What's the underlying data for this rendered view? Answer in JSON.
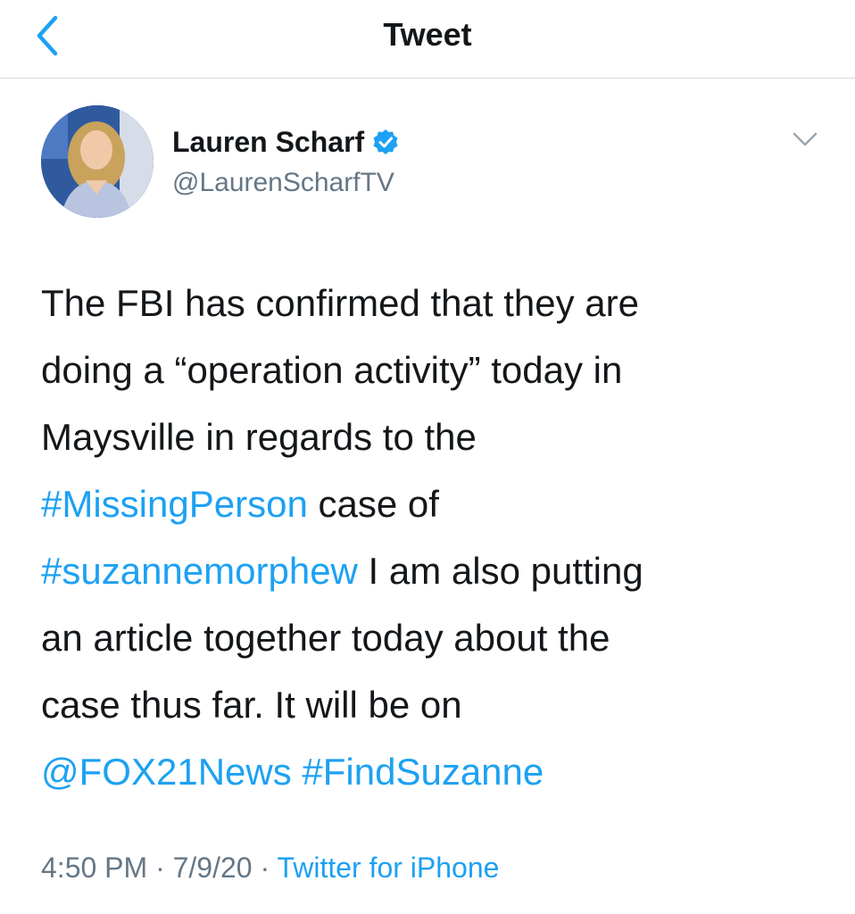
{
  "header": {
    "title": "Tweet"
  },
  "tweet": {
    "author_name": "Lauren Scharf",
    "handle": "@LaurenScharfTV",
    "verified": true,
    "text": {
      "line1": "The FBI has confirmed that they are",
      "line2": "doing a “operation activity” today in",
      "line3": "Maysville in regards to the",
      "line4_link": "#MissingPerson",
      "line4_text": " case of",
      "line5_link": "#suzannemorphew",
      "line5_text": " I am also putting",
      "line6": "an article together today about the",
      "line7": "case thus far. It will be on",
      "line8_link1": "@FOX21News",
      "line8_sep": " ",
      "line8_link2": "#FindSuzanne"
    },
    "time": "4:50 PM",
    "date": "7/9/20",
    "separator": " · ",
    "source": "Twitter for iPhone"
  },
  "colors": {
    "link": "#1da1f2",
    "text": "#14171a",
    "secondary": "#657786",
    "divider": "#d8d8d8"
  },
  "icons": {
    "back": "chevron-left-icon",
    "verified": "verified-badge-icon",
    "menu": "chevron-down-icon"
  }
}
